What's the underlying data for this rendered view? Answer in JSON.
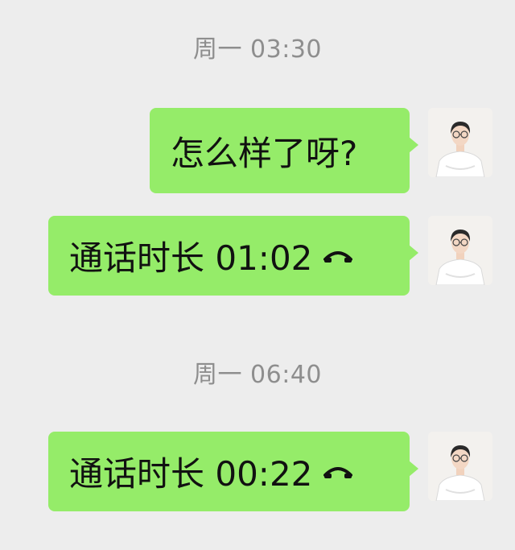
{
  "chat": {
    "timestamps": [
      "周一 03:30",
      "周一 06:40"
    ],
    "messages": [
      {
        "type": "text",
        "text": "怎么样了呀?"
      },
      {
        "type": "call",
        "label": "通话时长 01:02",
        "icon": "phone-hangup-icon"
      },
      {
        "type": "call",
        "label": "通话时长 00:22",
        "icon": "phone-hangup-icon"
      }
    ]
  },
  "colors": {
    "background": "#ededed",
    "bubble": "#95ec69",
    "timestamp": "#8e8e8e",
    "text": "#111111"
  }
}
